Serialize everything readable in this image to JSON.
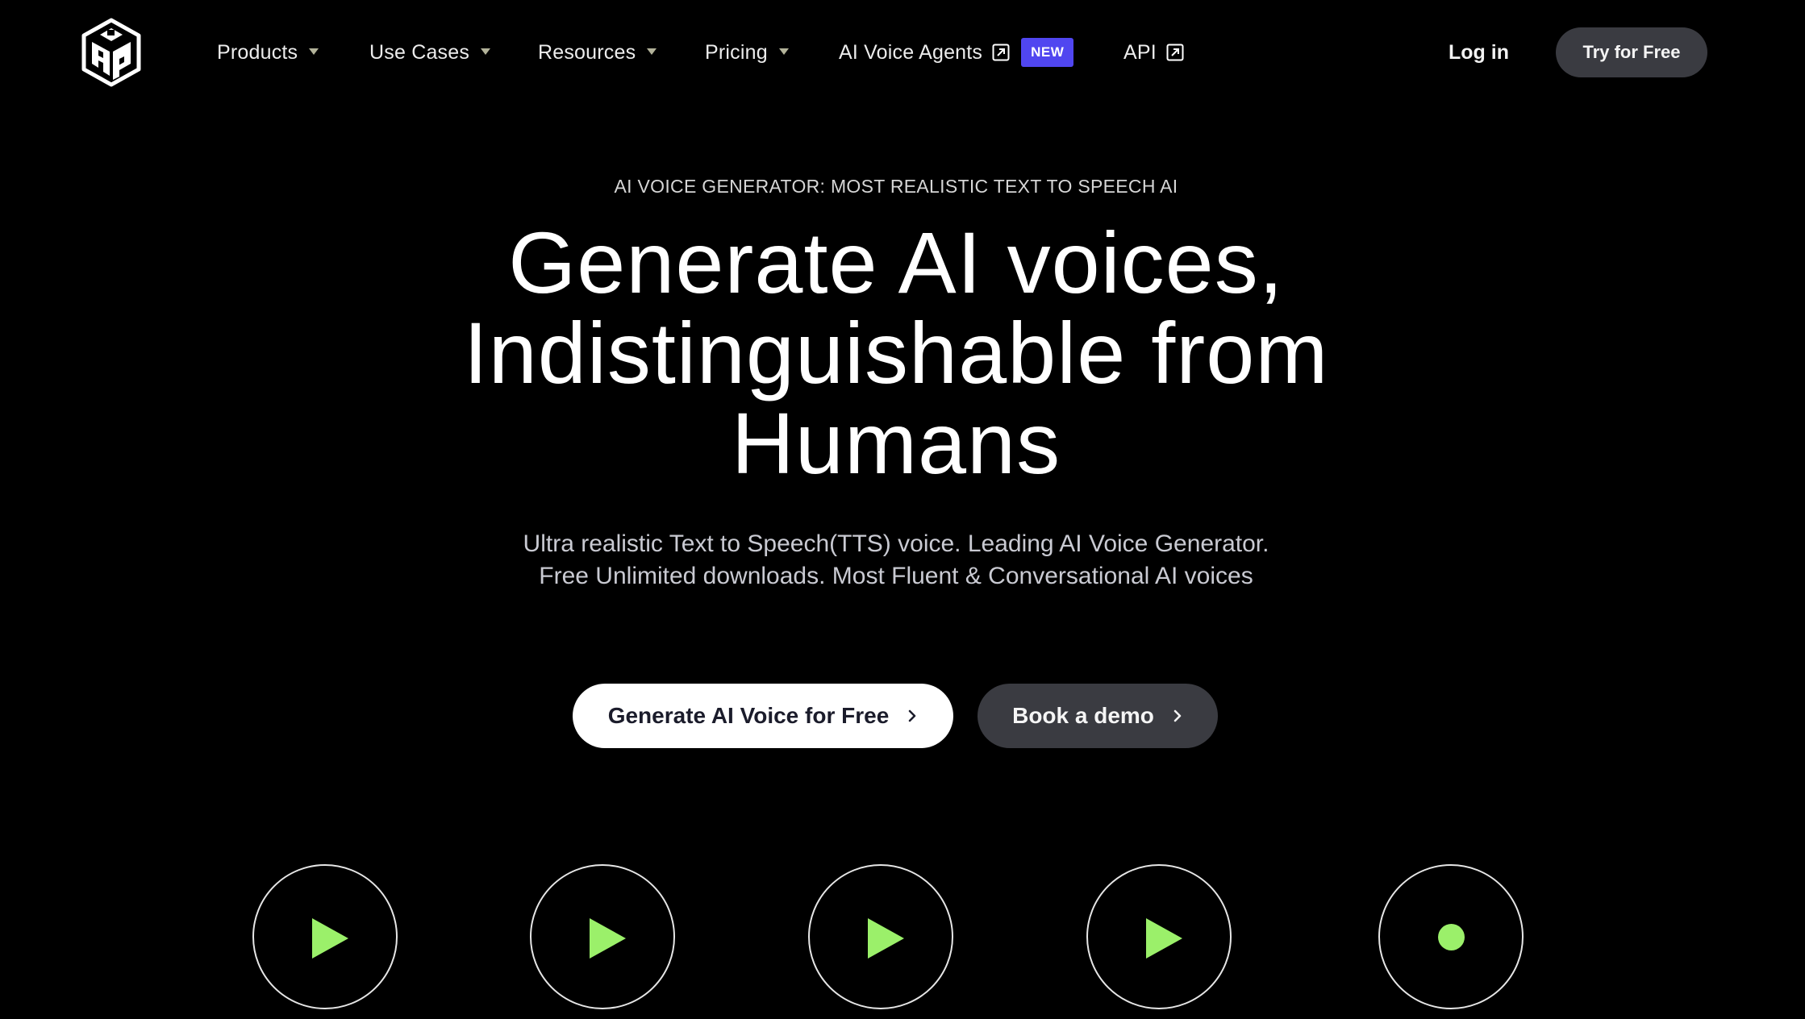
{
  "nav": {
    "logo_alt": "PlayHT logo",
    "items": [
      {
        "label": "Products",
        "has_dropdown": true
      },
      {
        "label": "Use Cases",
        "has_dropdown": true
      },
      {
        "label": "Resources",
        "has_dropdown": true
      },
      {
        "label": "Pricing",
        "has_dropdown": true
      },
      {
        "label": "AI Voice Agents",
        "icon": "external-link-icon",
        "badge": "NEW"
      },
      {
        "label": "API",
        "icon": "external-link-icon"
      }
    ],
    "login_label": "Log in",
    "try_label": "Try for Free"
  },
  "hero": {
    "eyebrow": "AI VOICE GENERATOR: MOST REALISTIC TEXT TO SPEECH AI",
    "headline_lines": [
      "Generate AI voices,",
      "Indistinguishable from",
      "Humans"
    ],
    "subtitle_lines": [
      "Ultra realistic Text to Speech(TTS) voice. Leading AI Voice Generator.",
      "Free Unlimited downloads. Most Fluent & Conversational AI voices"
    ],
    "cta_primary": "Generate AI Voice for Free",
    "cta_secondary": "Book a demo"
  },
  "voice_samples": [
    {
      "icon": "play-icon",
      "state": "paused"
    },
    {
      "icon": "play-icon",
      "state": "paused"
    },
    {
      "icon": "play-icon",
      "state": "paused"
    },
    {
      "icon": "play-icon",
      "state": "paused"
    },
    {
      "icon": "record-dot-icon",
      "state": "active"
    }
  ],
  "colors": {
    "background": "#000000",
    "accent_green": "#9bf06a",
    "badge_purple": "#5046f0",
    "button_dark": "#3a3b41",
    "button_light": "#ffffff"
  }
}
